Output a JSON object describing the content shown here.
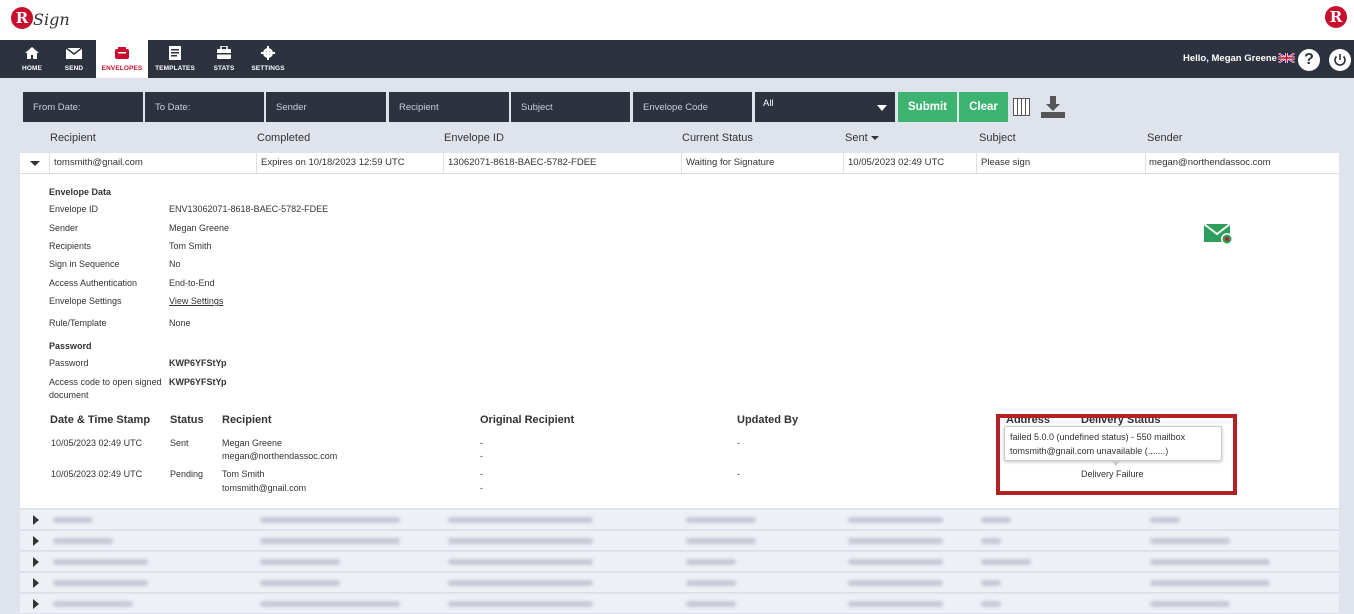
{
  "app": {
    "logo_letter": "R",
    "logo_text": "Sign"
  },
  "nav": {
    "items": [
      {
        "label": "HOME",
        "icon": "home-icon"
      },
      {
        "label": "SEND",
        "icon": "mail-icon"
      },
      {
        "label": "ENVELOPES",
        "icon": "envelopes-icon"
      },
      {
        "label": "TEMPLATES",
        "icon": "templates-icon"
      },
      {
        "label": "STATS",
        "icon": "stats-icon"
      },
      {
        "label": "SETTINGS",
        "icon": "gear-icon"
      }
    ],
    "active": "ENVELOPES",
    "greeting": "Hello, Megan Greene",
    "help_symbol": "?"
  },
  "filters": {
    "from_date": "From Date:",
    "to_date": "To Date:",
    "sender": "Sender",
    "recipient": "Recipient",
    "subject": "Subject",
    "envelope_code": "Envelope Code",
    "status_value": "All",
    "submit": "Submit",
    "clear": "Clear"
  },
  "columns": [
    "Recipient",
    "Completed",
    "Envelope ID",
    "Current Status",
    "Sent",
    "Subject",
    "Sender"
  ],
  "expanded_row": {
    "recipient": "tomsmith@gnail.com",
    "completed": "Expires on 10/18/2023 12:59 UTC",
    "envelope_id": "13062071-8618-BAEC-5782-FDEE",
    "status": "Waiting for Signature",
    "sent": "10/05/2023 02:49 UTC",
    "subject": "Please sign",
    "sender": "megan@northendassoc.com"
  },
  "envelope_data": {
    "heading": "Envelope Data",
    "envelope_id_label": "Envelope ID",
    "envelope_id": "ENV13062071-8618-BAEC-5782-FDEE",
    "sender_label": "Sender",
    "sender": "Megan Greene",
    "recipients_label": "Recipients",
    "recipients": "Tom Smith",
    "sequence_label": "Sign in Sequence",
    "sequence": "No",
    "auth_label": "Access Authentication",
    "auth": "End-to-End",
    "settings_label": "Envelope Settings",
    "settings_link": "View Settings",
    "rule_label": "Rule/Template",
    "rule": "None",
    "password_heading": "Password",
    "password_label": "Password",
    "password": "KWP6YFStYp",
    "access_code_label_1": "Access code to open signed",
    "access_code_label_2": "document",
    "access_code": "KWP6YFStYp"
  },
  "history": {
    "headers": [
      "Date & Time Stamp",
      "Status",
      "Recipient",
      "Original Recipient",
      "Updated By",
      "Address",
      "Delivery Status"
    ],
    "rows": [
      {
        "date": "10/05/2023 02:49 UTC",
        "status": "Sent",
        "name": "Megan Greene",
        "email": "megan@northendassoc.com",
        "orig1": "-",
        "orig2": "-",
        "updated": "-",
        "delivery": ""
      },
      {
        "date": "10/05/2023 02:49 UTC",
        "status": "Pending",
        "name": "Tom Smith",
        "email": "tomsmith@gnail.com",
        "orig1": "-",
        "orig2": "-",
        "updated": "-",
        "delivery": "Delivery Failure"
      }
    ],
    "tooltip_line1": "failed 5.0.0 (undefined status) - 550 mailbox",
    "tooltip_line2": "tomsmith@gnail.com unavailable (...",
    "tooltip_line2_suffix": "....)"
  },
  "colors": {
    "nav_bg": "#2c323e",
    "accent_red": "#c8102e",
    "button_green": "#3cb371",
    "highlight_box": "#b22222"
  }
}
